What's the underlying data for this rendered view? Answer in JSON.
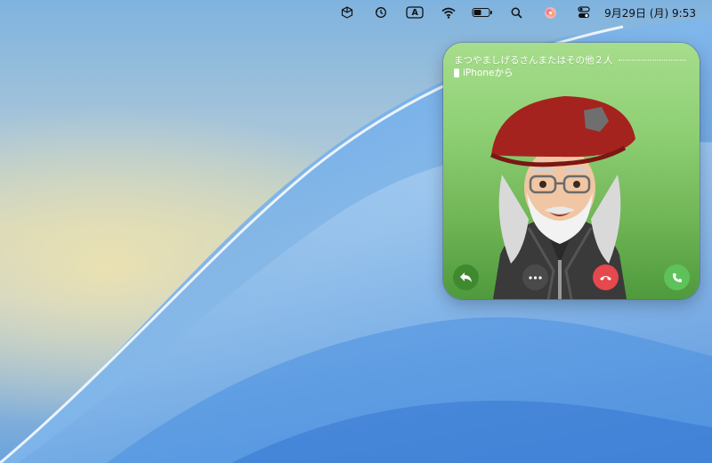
{
  "menubar": {
    "icons": [
      "cube-icon",
      "time-machine-icon",
      "input-method-icon",
      "wifi-icon",
      "battery-icon",
      "spotlight-icon",
      "siri-icon",
      "control-center-icon"
    ],
    "input_method_label": "A",
    "clock": "9月29日 (月)  9:53"
  },
  "call": {
    "caller": "まつやましげるさんまたはその他２人",
    "source": "iPhoneから",
    "buttons": [
      "reply-icon",
      "more-icon",
      "decline-icon",
      "accept-icon"
    ],
    "colors": {
      "decline": "#e5484d",
      "accept": "#5ec25a",
      "reply": "#3f8a2e",
      "more": "#4a4a4a"
    }
  }
}
